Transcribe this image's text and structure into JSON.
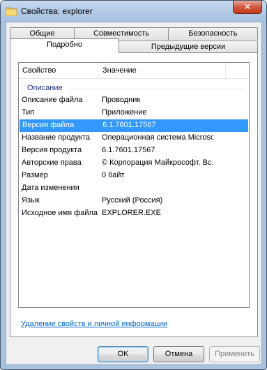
{
  "window": {
    "title": "Свойства: explorer",
    "close_label": "✕"
  },
  "tabs": {
    "row1": [
      "Общие",
      "Совместимость",
      "Безопасность"
    ],
    "row2": [
      "Подробно",
      "Предыдущие версии"
    ],
    "active": "Подробно"
  },
  "details": {
    "columns": {
      "property": "Свойство",
      "value": "Значение"
    },
    "group": "Описание",
    "rows": [
      {
        "property": "Описание файла",
        "value": "Проводник"
      },
      {
        "property": "Тип",
        "value": "Приложение"
      },
      {
        "property": "Версия файла",
        "value": "6.1.7601.17567"
      },
      {
        "property": "Название продукта",
        "value": "Операционная система Microso..."
      },
      {
        "property": "Версия продукта",
        "value": "6.1.7601.17567"
      },
      {
        "property": "Авторские права",
        "value": "© Корпорация Майкрософт. Вс..."
      },
      {
        "property": "Размер",
        "value": "0 байт"
      },
      {
        "property": "Дата изменения",
        "value": ""
      },
      {
        "property": "Язык",
        "value": "Русский (Россия)"
      },
      {
        "property": "Исходное имя файла",
        "value": "EXPLORER.EXE"
      }
    ],
    "selected_row": "Версия файла"
  },
  "remove_link": "Удаление свойств и личной информации",
  "buttons": {
    "ok": "OK",
    "cancel": "Отмена",
    "apply": "Применить"
  },
  "colors": {
    "selection": "#3399ff",
    "link": "#0066cc",
    "group_title": "#1e3287"
  },
  "icons": {
    "app": "folder-icon",
    "close": "close-icon"
  }
}
